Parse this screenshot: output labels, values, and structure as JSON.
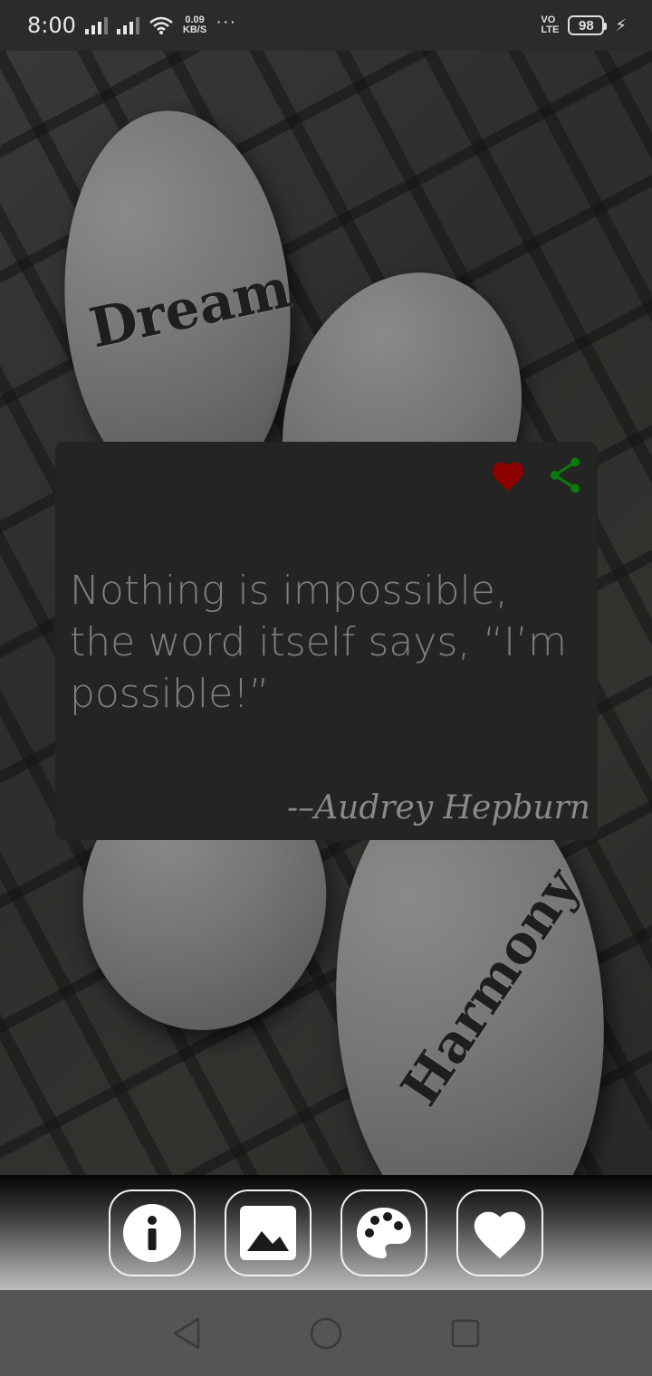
{
  "status_bar": {
    "time": "8:00",
    "network_speed_value": "0.09",
    "network_speed_unit": "KB/S",
    "more_indicator": "···",
    "volte_top": "VO",
    "volte_bottom": "LTE",
    "battery_level": "98"
  },
  "background": {
    "stone_words": [
      "Dream",
      "Harmony"
    ]
  },
  "quote_card": {
    "text": "Nothing is impossible, the word itself says, “I’m possible!”",
    "author": "-–Audrey Hepburn",
    "favorite_icon_color": "#8b0000",
    "share_icon_color": "#0a7a0a"
  },
  "toolbar": {
    "buttons": [
      {
        "icon": "info-icon"
      },
      {
        "icon": "image-icon"
      },
      {
        "icon": "palette-icon"
      },
      {
        "icon": "heart-icon"
      }
    ]
  },
  "nav_bar": {
    "buttons": [
      {
        "icon": "back-icon"
      },
      {
        "icon": "home-icon"
      },
      {
        "icon": "recents-icon"
      }
    ]
  }
}
